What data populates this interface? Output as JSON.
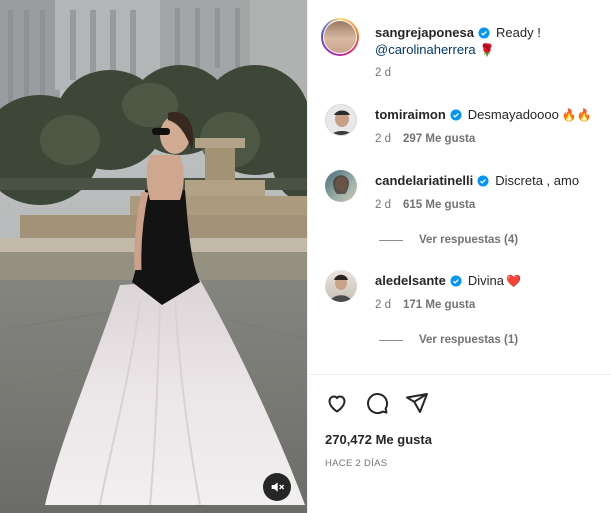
{
  "post": {
    "author": "sangrejaponesa",
    "caption": "Ready !",
    "mention": "@carolinaherrera",
    "emoji": "🌹",
    "time": "2 d"
  },
  "comments": [
    {
      "username": "tomiraimon",
      "text": "Desmayadoooo",
      "emoji": "🔥🔥",
      "time": "2 d",
      "likes": "297 Me gusta"
    },
    {
      "username": "candelariatinelli",
      "text": "Discreta , amo",
      "time": "2 d",
      "likes": "615 Me gusta",
      "replies": "Ver respuestas (4)"
    },
    {
      "username": "aledelsante",
      "text": "Divina",
      "emoji": "❤️",
      "time": "2 d",
      "likes": "171 Me gusta",
      "replies": "Ver respuestas (1)"
    }
  ],
  "actions": {
    "like_icon": "heart-icon",
    "comment_icon": "comment-icon",
    "share_icon": "send-icon"
  },
  "summary": {
    "likes": "270,472 Me gusta",
    "date": "HACE 2 DÍAS"
  },
  "colors": {
    "verified": "#0095f6",
    "mention": "#00376b",
    "meta": "#737373"
  },
  "media": {
    "mute_icon": "sound-off-icon"
  }
}
